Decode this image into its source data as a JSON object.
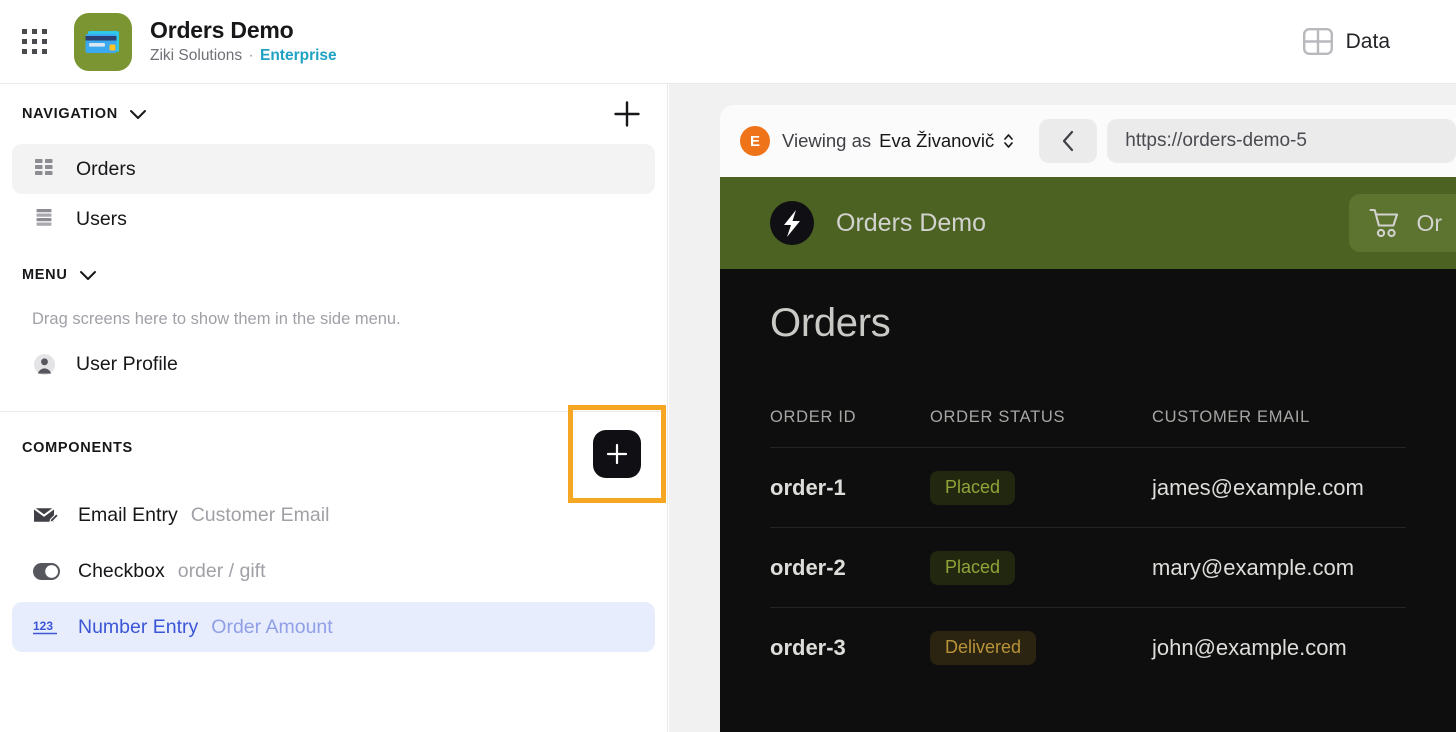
{
  "topbar": {
    "apps_grid_icon": "apps-grid-icon",
    "app_icon": "credit-card-app-icon",
    "app_name": "Orders Demo",
    "org_name": "Ziki Solutions",
    "separator": "·",
    "plan": "Enterprise",
    "data_icon": "table-layout-icon",
    "data_label": "Data"
  },
  "sidebar": {
    "navigation": {
      "title": "NAVIGATION",
      "collapse_icon": "chevron-down-icon",
      "add_icon": "plus-icon",
      "items": [
        {
          "label": "Orders",
          "icon": "table-grid-icon",
          "selected": true
        },
        {
          "label": "Users",
          "icon": "list-rows-icon",
          "selected": false
        }
      ]
    },
    "menu": {
      "title": "MENU",
      "collapse_icon": "chevron-down-icon",
      "hint": "Drag screens here to show them in the side menu.",
      "items": [
        {
          "label": "User Profile",
          "icon": "person-icon"
        }
      ]
    },
    "components": {
      "title": "COMPONENTS",
      "add_button_icon": "plus-icon",
      "add_button_highlight_color": "#f5a623",
      "items": [
        {
          "name": "Email Entry",
          "meta": "Customer Email",
          "icon": "envelope-edit-icon",
          "selected": false
        },
        {
          "name": "Checkbox",
          "meta": "order / gift",
          "icon": "toggle-switch-icon",
          "selected": false
        },
        {
          "name": "Number Entry",
          "meta": "Order Amount",
          "icon": "number-123-icon",
          "selected": true
        }
      ]
    }
  },
  "preview": {
    "viewing_as_prefix": "Viewing as",
    "viewing_as_user": "Eva Živanovič",
    "avatar_initial": "E",
    "avatar_color": "#ef7318",
    "selector_icon": "chevron-up-down-icon",
    "back_icon": "chevron-left-icon",
    "url": "https://orders-demo-5",
    "app_bar": {
      "logo_icon": "lightning-bolt-logo",
      "title": "Orders Demo",
      "bg_color": "#4c6222",
      "cart_icon": "shopping-cart-icon",
      "cart_label": "Or"
    },
    "page_title": "Orders",
    "table": {
      "columns": [
        "ORDER ID",
        "ORDER STATUS",
        "CUSTOMER EMAIL"
      ],
      "rows": [
        {
          "id": "order-1",
          "status": "Placed",
          "status_kind": "placed",
          "email": "james@example.com"
        },
        {
          "id": "order-2",
          "status": "Placed",
          "status_kind": "placed",
          "email": "mary@example.com"
        },
        {
          "id": "order-3",
          "status": "Delivered",
          "status_kind": "delivered",
          "email": "john@example.com"
        }
      ]
    }
  }
}
